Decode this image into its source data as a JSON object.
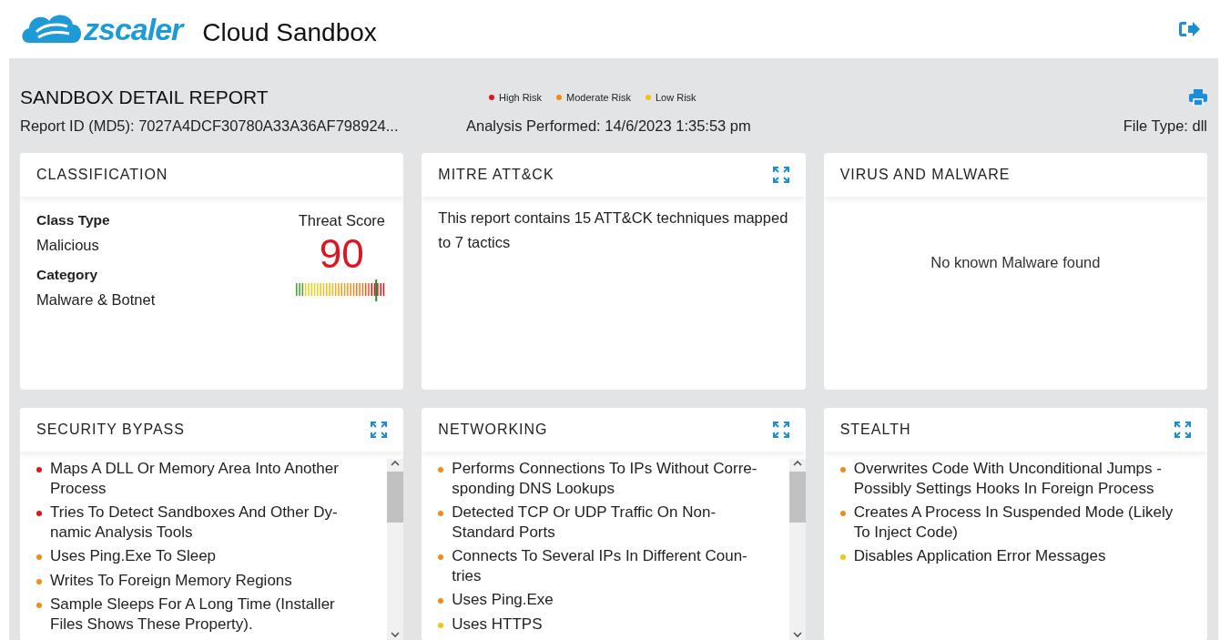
{
  "header": {
    "brand": "zscaler",
    "title": "Cloud Sandbox"
  },
  "report": {
    "title": "SANDBOX DETAIL REPORT",
    "report_id": "Report ID (MD5): 7027A4DCF30780A33A36AF798924...",
    "analysis": "Analysis Performed: 14/6/2023 1:35:53 pm",
    "file_type": "File Type: dll"
  },
  "legend": [
    {
      "label": "High Risk",
      "color": "#e0141e"
    },
    {
      "label": "Moderate Risk",
      "color": "#f08c1a"
    },
    {
      "label": "Low Risk",
      "color": "#f2c40f"
    }
  ],
  "classification": {
    "title": "CLASSIFICATION",
    "class_type_label": "Class Type",
    "class_type": "Malicious",
    "category_label": "Category",
    "category": "Malware & Botnet",
    "score_label": "Threat Score",
    "score": "90",
    "level": 0.9
  },
  "mitre": {
    "title": "MITRE ATT&CK",
    "expandable": true,
    "text": "This report contains 15 ATT&CK techniques mapped to 7 tactics"
  },
  "virus": {
    "title": "VIRUS AND MALWARE",
    "expandable": false,
    "message": "No known Malware found"
  },
  "panels": [
    {
      "title": "SECURITY BYPASS",
      "expandable": true,
      "scrollbar": true,
      "items": [
        {
          "lines": [
            "Maps A DLL Or Memory Area Into Another",
            "Process"
          ],
          "color": "#e0141e"
        },
        {
          "lines": [
            "Tries To Detect Sandboxes And Other Dy-",
            "namic Analysis Tools"
          ],
          "color": "#e0141e"
        },
        {
          "lines": [
            "Uses Ping.Exe To Sleep"
          ],
          "color": "#f08c1a"
        },
        {
          "lines": [
            "Writes To Foreign Memory Regions"
          ],
          "color": "#f08c1a"
        },
        {
          "lines": [
            "Sample Sleeps For A Long Time (Installer",
            "Files Shows These Property)."
          ],
          "color": "#f08c1a"
        }
      ]
    },
    {
      "title": "NETWORKING",
      "expandable": true,
      "scrollbar": true,
      "items": [
        {
          "lines": [
            "Performs Connections To IPs Without Corre-",
            "sponding DNS Lookups"
          ],
          "color": "#f08c1a"
        },
        {
          "lines": [
            "Detected TCP Or UDP Traffic On Non-",
            "Standard Ports"
          ],
          "color": "#f08c1a"
        },
        {
          "lines": [
            "Connects To Several IPs In Different Coun-",
            "tries"
          ],
          "color": "#f08c1a"
        },
        {
          "lines": [
            "Uses Ping.Exe"
          ],
          "color": "#f08c1a"
        },
        {
          "lines": [
            "Uses HTTPS"
          ],
          "color": "#f2c40f"
        }
      ]
    },
    {
      "title": "STEALTH",
      "expandable": true,
      "scrollbar": false,
      "items": [
        {
          "lines": [
            "Overwrites Code With Unconditional Jumps -",
            "Possibly Settings Hooks In Foreign Process"
          ],
          "color": "#f08c1a"
        },
        {
          "lines": [
            "Creates A Process In Suspended Mode (Likely",
            "To Inject Code)"
          ],
          "color": "#f08c1a"
        },
        {
          "lines": [
            "Disables Application Error Messages"
          ],
          "color": "#f2c40f"
        }
      ]
    }
  ]
}
